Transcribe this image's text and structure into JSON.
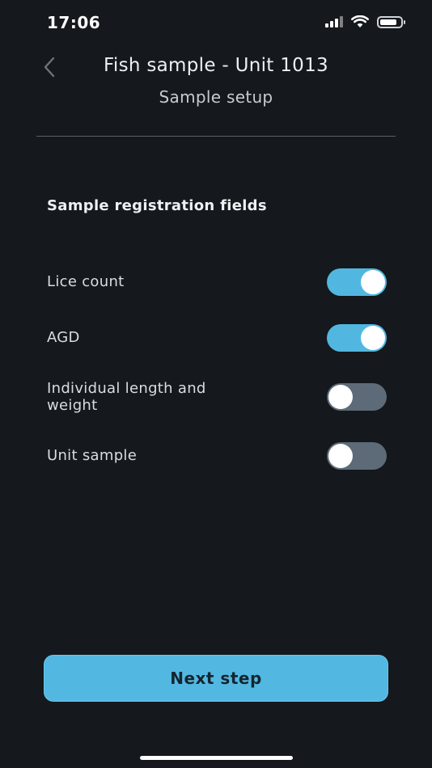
{
  "status_bar": {
    "time": "17:06",
    "icons": [
      "cellular-signal-icon",
      "wifi-icon",
      "battery-icon"
    ]
  },
  "header": {
    "back_icon": "chevron-left-icon",
    "title": "Fish sample - Unit 1013",
    "subtitle": "Sample setup"
  },
  "section": {
    "title": "Sample registration fields",
    "fields": [
      {
        "label": "Lice count",
        "enabled": true
      },
      {
        "label": "AGD",
        "enabled": true
      },
      {
        "label": "Individual length and weight",
        "enabled": false
      },
      {
        "label": "Unit sample",
        "enabled": false
      }
    ]
  },
  "footer": {
    "next_label": "Next step"
  },
  "colors": {
    "background": "#15181c",
    "accent": "#52b8e2",
    "toggle_off": "#5d6b78"
  }
}
